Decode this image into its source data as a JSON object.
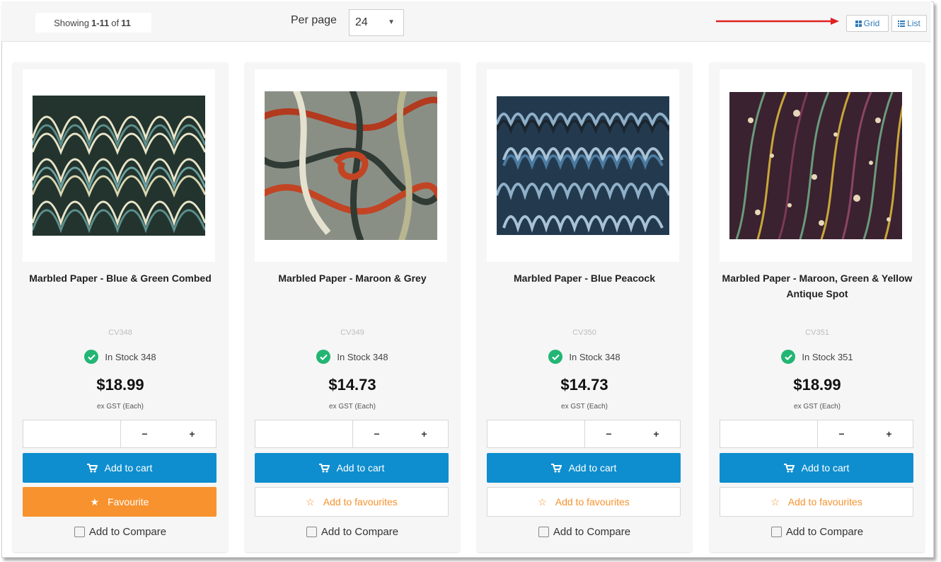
{
  "toolbar": {
    "showing_prefix": "Showing",
    "showing_range": "1-11",
    "showing_of": "of",
    "showing_total": "11",
    "per_page_label": "Per page",
    "per_page_value": "24",
    "grid_label": "Grid",
    "list_label": "List",
    "accent_color": "#337ab7",
    "annotation_arrow_color": "#e02020"
  },
  "products": [
    {
      "name": "Marbled Paper - Blue & Green Combed",
      "sku": "CV348",
      "stock": "In Stock 348",
      "price": "$18.99",
      "tax_note": "ex GST (Each)",
      "minus": "−",
      "plus": "+",
      "cart_label": "Add to cart",
      "fav_label": "Favourite",
      "fav_active": true,
      "compare_label": "Add to Compare"
    },
    {
      "name": "Marbled Paper - Maroon & Grey",
      "sku": "CV349",
      "stock": "In Stock 348",
      "price": "$14.73",
      "tax_note": "ex GST (Each)",
      "minus": "−",
      "plus": "+",
      "cart_label": "Add to cart",
      "fav_label": "Add to favourites",
      "fav_active": false,
      "compare_label": "Add to Compare"
    },
    {
      "name": "Marbled Paper - Blue Peacock",
      "sku": "CV350",
      "stock": "In Stock 348",
      "price": "$14.73",
      "tax_note": "ex GST (Each)",
      "minus": "−",
      "plus": "+",
      "cart_label": "Add to cart",
      "fav_label": "Add to favourites",
      "fav_active": false,
      "compare_label": "Add to Compare"
    },
    {
      "name": "Marbled Paper - Maroon, Green & Yellow Antique Spot",
      "sku": "CV351",
      "stock": "In Stock 351",
      "price": "$18.99",
      "tax_note": "ex GST (Each)",
      "minus": "−",
      "plus": "+",
      "cart_label": "Add to cart",
      "fav_label": "Add to favourites",
      "fav_active": false,
      "compare_label": "Add to Compare"
    }
  ],
  "colors": {
    "cart_button": "#0e8ecf",
    "favourite": "#f7922e",
    "in_stock": "#22b573"
  }
}
